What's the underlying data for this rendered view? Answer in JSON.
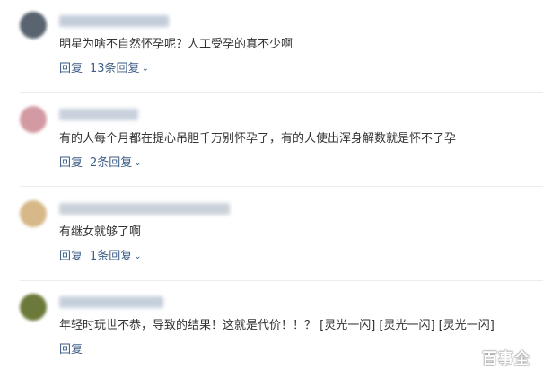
{
  "comments": [
    {
      "text": "明星为啥不自然怀孕呢？人工受孕的真不少啊",
      "reply_label": "回复",
      "reply_count": "13条回复",
      "avatar_color": "#5a6470",
      "username_color": "#b9c4d4"
    },
    {
      "text": "有的人每个月都在提心吊胆千万别怀孕了，有的人使出浑身解数就是怀不了孕",
      "reply_label": "回复",
      "reply_count": "2条回复",
      "avatar_color": "#d49aa3",
      "username_color": "#c0cad8"
    },
    {
      "text": "有继女就够了啊",
      "reply_label": "回复",
      "reply_count": "1条回复",
      "avatar_color": "#d7b889",
      "username_color": "#c2c9d2"
    },
    {
      "text": "年轻时玩世不恭，导致的结果！这就是代价！！？ [灵光一闪] [灵光一闪] [灵光一闪]",
      "reply_label": "回复",
      "reply_count": "",
      "avatar_color": "#6b7a3a",
      "username_color": "#bcc7d6"
    }
  ],
  "watermark": "百事全"
}
